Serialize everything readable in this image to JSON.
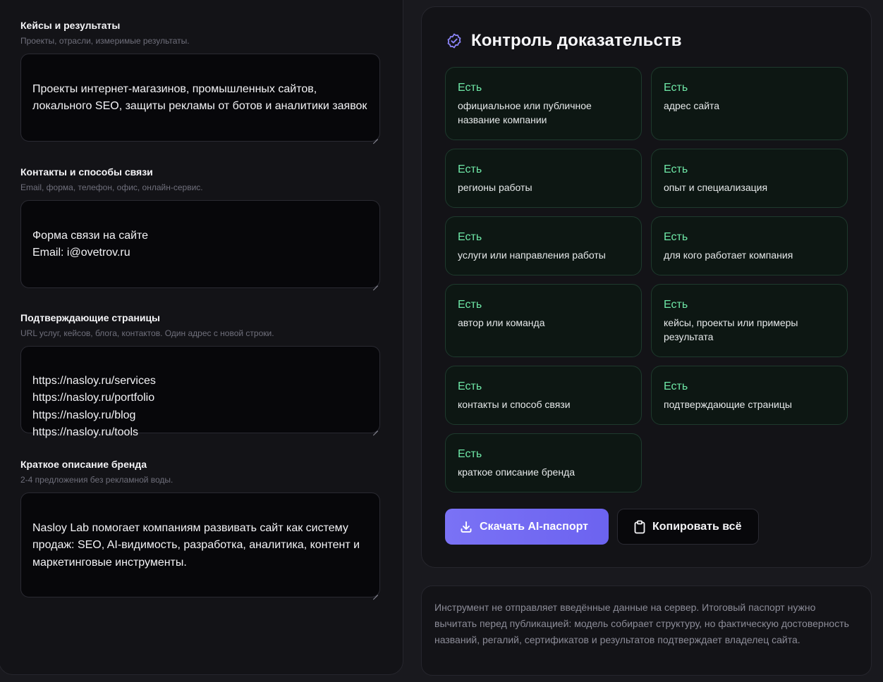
{
  "form": {
    "cases": {
      "label": "Кейсы и результаты",
      "hint": "Проекты, отрасли, измеримые результаты.",
      "value": "Проекты интернет-магазинов, промышленных сайтов, локального SEO, защиты рекламы от ботов и аналитики заявок"
    },
    "contacts": {
      "label": "Контакты и способы связи",
      "hint": "Email, форма, телефон, офис, онлайн-сервис.",
      "value": "Форма связи на сайте\nEmail: i@ovetrov.ru"
    },
    "pages": {
      "label": "Подтверждающие страницы",
      "hint": "URL услуг, кейсов, блога, контактов. Один адрес с новой строки.",
      "value": "https://nasloy.ru/services\nhttps://nasloy.ru/portfolio\nhttps://nasloy.ru/blog\nhttps://nasloy.ru/tools"
    },
    "brand": {
      "label": "Краткое описание бренда",
      "hint": "2-4 предложения без рекламной воды.",
      "value": "Nasloy Lab помогает компаниям развивать сайт как систему продаж: SEO, AI-видимость, разработка, аналитика, контент и маркетинговые инструменты."
    }
  },
  "evidence": {
    "title": "Контроль доказательств",
    "icon": "badge-check-icon",
    "items": [
      {
        "status": "Есть",
        "text": "официальное или публичное название компании"
      },
      {
        "status": "Есть",
        "text": "адрес сайта"
      },
      {
        "status": "Есть",
        "text": "регионы работы"
      },
      {
        "status": "Есть",
        "text": "опыт и специализация"
      },
      {
        "status": "Есть",
        "text": "услуги или направления работы"
      },
      {
        "status": "Есть",
        "text": "для кого работает компания"
      },
      {
        "status": "Есть",
        "text": "автор или команда"
      },
      {
        "status": "Есть",
        "text": "кейсы, проекты или примеры результата"
      },
      {
        "status": "Есть",
        "text": "контакты и способ связи"
      },
      {
        "status": "Есть",
        "text": "подтверждающие страницы"
      },
      {
        "status": "Есть",
        "text": "краткое описание бренда"
      }
    ],
    "download_label": "Скачать AI-паспорт",
    "copy_label": "Копировать всё"
  },
  "note": "Инструмент не отправляет введённые данные на сервер. Итоговый паспорт нужно вычитать перед публикацией: модель собирает структуру, но фактическую достоверность названий, регалий, сертификатов и результатов подтверждает владелец сайта.",
  "colors": {
    "accent": "#6c63f0",
    "status": "#6ee7a6",
    "card_bg": "#0d1713"
  }
}
